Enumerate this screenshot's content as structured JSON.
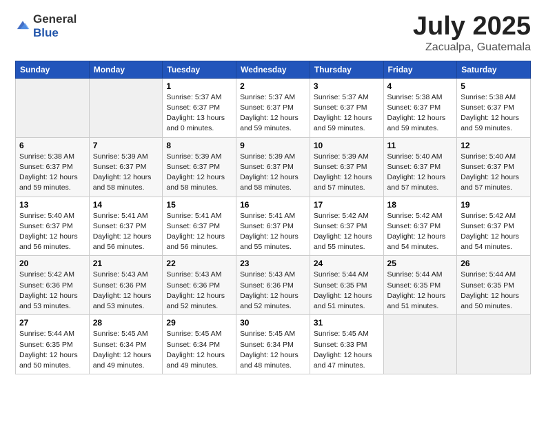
{
  "logo": {
    "general": "General",
    "blue": "Blue"
  },
  "calendar": {
    "title": "July 2025",
    "subtitle": "Zacualpa, Guatemala",
    "days": [
      "Sunday",
      "Monday",
      "Tuesday",
      "Wednesday",
      "Thursday",
      "Friday",
      "Saturday"
    ],
    "weeks": [
      [
        {
          "num": "",
          "sunrise": "",
          "sunset": "",
          "daylight": "",
          "empty": true
        },
        {
          "num": "",
          "sunrise": "",
          "sunset": "",
          "daylight": "",
          "empty": true
        },
        {
          "num": "1",
          "sunrise": "Sunrise: 5:37 AM",
          "sunset": "Sunset: 6:37 PM",
          "daylight": "Daylight: 13 hours and 0 minutes."
        },
        {
          "num": "2",
          "sunrise": "Sunrise: 5:37 AM",
          "sunset": "Sunset: 6:37 PM",
          "daylight": "Daylight: 12 hours and 59 minutes."
        },
        {
          "num": "3",
          "sunrise": "Sunrise: 5:37 AM",
          "sunset": "Sunset: 6:37 PM",
          "daylight": "Daylight: 12 hours and 59 minutes."
        },
        {
          "num": "4",
          "sunrise": "Sunrise: 5:38 AM",
          "sunset": "Sunset: 6:37 PM",
          "daylight": "Daylight: 12 hours and 59 minutes."
        },
        {
          "num": "5",
          "sunrise": "Sunrise: 5:38 AM",
          "sunset": "Sunset: 6:37 PM",
          "daylight": "Daylight: 12 hours and 59 minutes."
        }
      ],
      [
        {
          "num": "6",
          "sunrise": "Sunrise: 5:38 AM",
          "sunset": "Sunset: 6:37 PM",
          "daylight": "Daylight: 12 hours and 59 minutes."
        },
        {
          "num": "7",
          "sunrise": "Sunrise: 5:39 AM",
          "sunset": "Sunset: 6:37 PM",
          "daylight": "Daylight: 12 hours and 58 minutes."
        },
        {
          "num": "8",
          "sunrise": "Sunrise: 5:39 AM",
          "sunset": "Sunset: 6:37 PM",
          "daylight": "Daylight: 12 hours and 58 minutes."
        },
        {
          "num": "9",
          "sunrise": "Sunrise: 5:39 AM",
          "sunset": "Sunset: 6:37 PM",
          "daylight": "Daylight: 12 hours and 58 minutes."
        },
        {
          "num": "10",
          "sunrise": "Sunrise: 5:39 AM",
          "sunset": "Sunset: 6:37 PM",
          "daylight": "Daylight: 12 hours and 57 minutes."
        },
        {
          "num": "11",
          "sunrise": "Sunrise: 5:40 AM",
          "sunset": "Sunset: 6:37 PM",
          "daylight": "Daylight: 12 hours and 57 minutes."
        },
        {
          "num": "12",
          "sunrise": "Sunrise: 5:40 AM",
          "sunset": "Sunset: 6:37 PM",
          "daylight": "Daylight: 12 hours and 57 minutes."
        }
      ],
      [
        {
          "num": "13",
          "sunrise": "Sunrise: 5:40 AM",
          "sunset": "Sunset: 6:37 PM",
          "daylight": "Daylight: 12 hours and 56 minutes."
        },
        {
          "num": "14",
          "sunrise": "Sunrise: 5:41 AM",
          "sunset": "Sunset: 6:37 PM",
          "daylight": "Daylight: 12 hours and 56 minutes."
        },
        {
          "num": "15",
          "sunrise": "Sunrise: 5:41 AM",
          "sunset": "Sunset: 6:37 PM",
          "daylight": "Daylight: 12 hours and 56 minutes."
        },
        {
          "num": "16",
          "sunrise": "Sunrise: 5:41 AM",
          "sunset": "Sunset: 6:37 PM",
          "daylight": "Daylight: 12 hours and 55 minutes."
        },
        {
          "num": "17",
          "sunrise": "Sunrise: 5:42 AM",
          "sunset": "Sunset: 6:37 PM",
          "daylight": "Daylight: 12 hours and 55 minutes."
        },
        {
          "num": "18",
          "sunrise": "Sunrise: 5:42 AM",
          "sunset": "Sunset: 6:37 PM",
          "daylight": "Daylight: 12 hours and 54 minutes."
        },
        {
          "num": "19",
          "sunrise": "Sunrise: 5:42 AM",
          "sunset": "Sunset: 6:37 PM",
          "daylight": "Daylight: 12 hours and 54 minutes."
        }
      ],
      [
        {
          "num": "20",
          "sunrise": "Sunrise: 5:42 AM",
          "sunset": "Sunset: 6:36 PM",
          "daylight": "Daylight: 12 hours and 53 minutes."
        },
        {
          "num": "21",
          "sunrise": "Sunrise: 5:43 AM",
          "sunset": "Sunset: 6:36 PM",
          "daylight": "Daylight: 12 hours and 53 minutes."
        },
        {
          "num": "22",
          "sunrise": "Sunrise: 5:43 AM",
          "sunset": "Sunset: 6:36 PM",
          "daylight": "Daylight: 12 hours and 52 minutes."
        },
        {
          "num": "23",
          "sunrise": "Sunrise: 5:43 AM",
          "sunset": "Sunset: 6:36 PM",
          "daylight": "Daylight: 12 hours and 52 minutes."
        },
        {
          "num": "24",
          "sunrise": "Sunrise: 5:44 AM",
          "sunset": "Sunset: 6:35 PM",
          "daylight": "Daylight: 12 hours and 51 minutes."
        },
        {
          "num": "25",
          "sunrise": "Sunrise: 5:44 AM",
          "sunset": "Sunset: 6:35 PM",
          "daylight": "Daylight: 12 hours and 51 minutes."
        },
        {
          "num": "26",
          "sunrise": "Sunrise: 5:44 AM",
          "sunset": "Sunset: 6:35 PM",
          "daylight": "Daylight: 12 hours and 50 minutes."
        }
      ],
      [
        {
          "num": "27",
          "sunrise": "Sunrise: 5:44 AM",
          "sunset": "Sunset: 6:35 PM",
          "daylight": "Daylight: 12 hours and 50 minutes."
        },
        {
          "num": "28",
          "sunrise": "Sunrise: 5:45 AM",
          "sunset": "Sunset: 6:34 PM",
          "daylight": "Daylight: 12 hours and 49 minutes."
        },
        {
          "num": "29",
          "sunrise": "Sunrise: 5:45 AM",
          "sunset": "Sunset: 6:34 PM",
          "daylight": "Daylight: 12 hours and 49 minutes."
        },
        {
          "num": "30",
          "sunrise": "Sunrise: 5:45 AM",
          "sunset": "Sunset: 6:34 PM",
          "daylight": "Daylight: 12 hours and 48 minutes."
        },
        {
          "num": "31",
          "sunrise": "Sunrise: 5:45 AM",
          "sunset": "Sunset: 6:33 PM",
          "daylight": "Daylight: 12 hours and 47 minutes."
        },
        {
          "num": "",
          "sunrise": "",
          "sunset": "",
          "daylight": "",
          "empty": true
        },
        {
          "num": "",
          "sunrise": "",
          "sunset": "",
          "daylight": "",
          "empty": true
        }
      ]
    ]
  }
}
